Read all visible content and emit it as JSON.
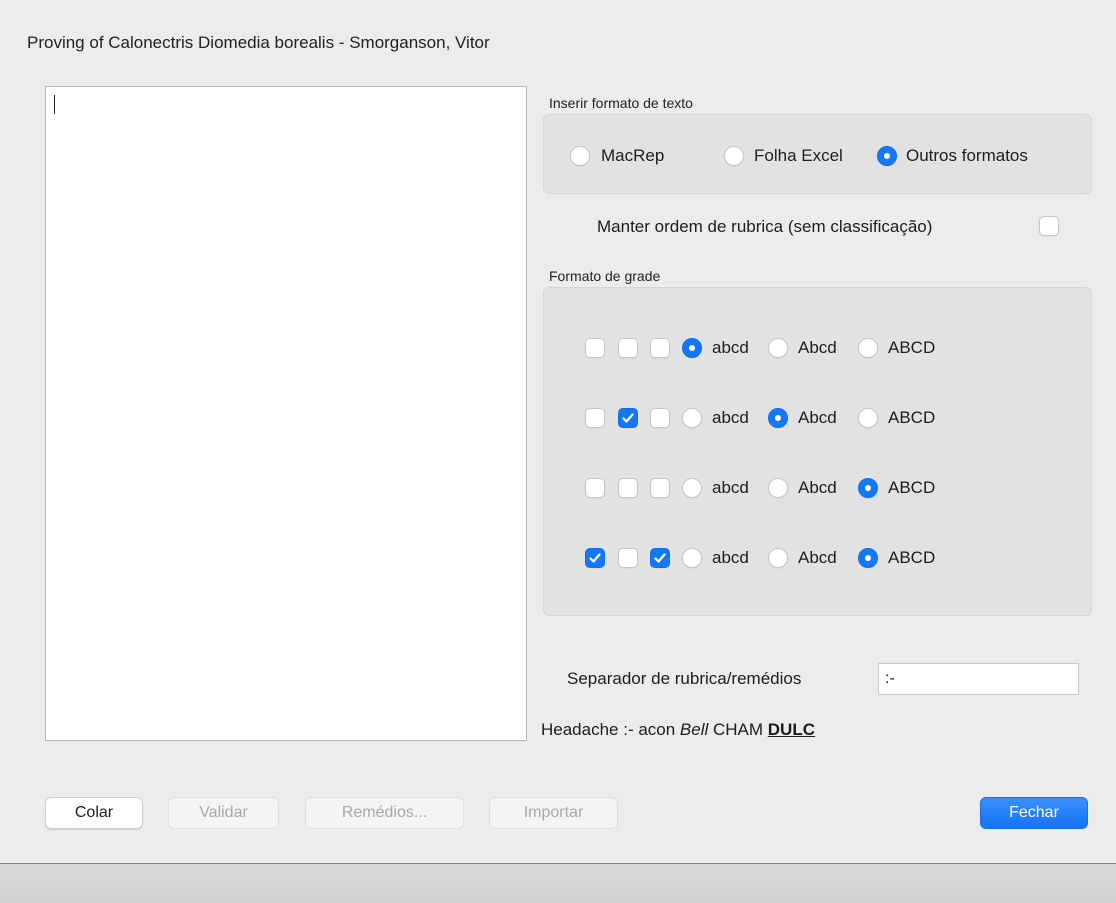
{
  "window": {
    "title": "Proving of Calonectris Diomedia borealis - Smorganson, Vitor"
  },
  "text_format": {
    "label": "Inserir formato de texto",
    "options": [
      {
        "label": "MacRep",
        "selected": false
      },
      {
        "label": "Folha Excel",
        "selected": false
      },
      {
        "label": "Outros formatos",
        "selected": true
      }
    ]
  },
  "keep_order": {
    "label": "Manter ordem de rubrica (sem classificação)",
    "checked": false
  },
  "grade_format": {
    "label": "Formato de grade",
    "rows": [
      {
        "checks": [
          false,
          false,
          false
        ],
        "options": [
          "abcd",
          "Abcd",
          "ABCD"
        ],
        "selected": "abcd"
      },
      {
        "checks": [
          false,
          true,
          false
        ],
        "options": [
          "abcd",
          "Abcd",
          "ABCD"
        ],
        "selected": "Abcd"
      },
      {
        "checks": [
          false,
          false,
          false
        ],
        "options": [
          "abcd",
          "Abcd",
          "ABCD"
        ],
        "selected": "ABCD"
      },
      {
        "checks": [
          true,
          false,
          true
        ],
        "options": [
          "abcd",
          "Abcd",
          "ABCD"
        ],
        "selected": "ABCD"
      }
    ]
  },
  "separator": {
    "label": "Separador de rubrica/remédios",
    "value": ":-"
  },
  "example": {
    "prefix": "Headache :- acon ",
    "italic": "Bell",
    "middle": " CHAM ",
    "bold_underline": "DULC"
  },
  "buttons": {
    "paste": "Colar",
    "validate": "Validar",
    "remedies": "Remédios...",
    "import": "Importar",
    "close": "Fechar"
  },
  "colors": {
    "accent": "#1478f6",
    "background": "#ececec"
  }
}
